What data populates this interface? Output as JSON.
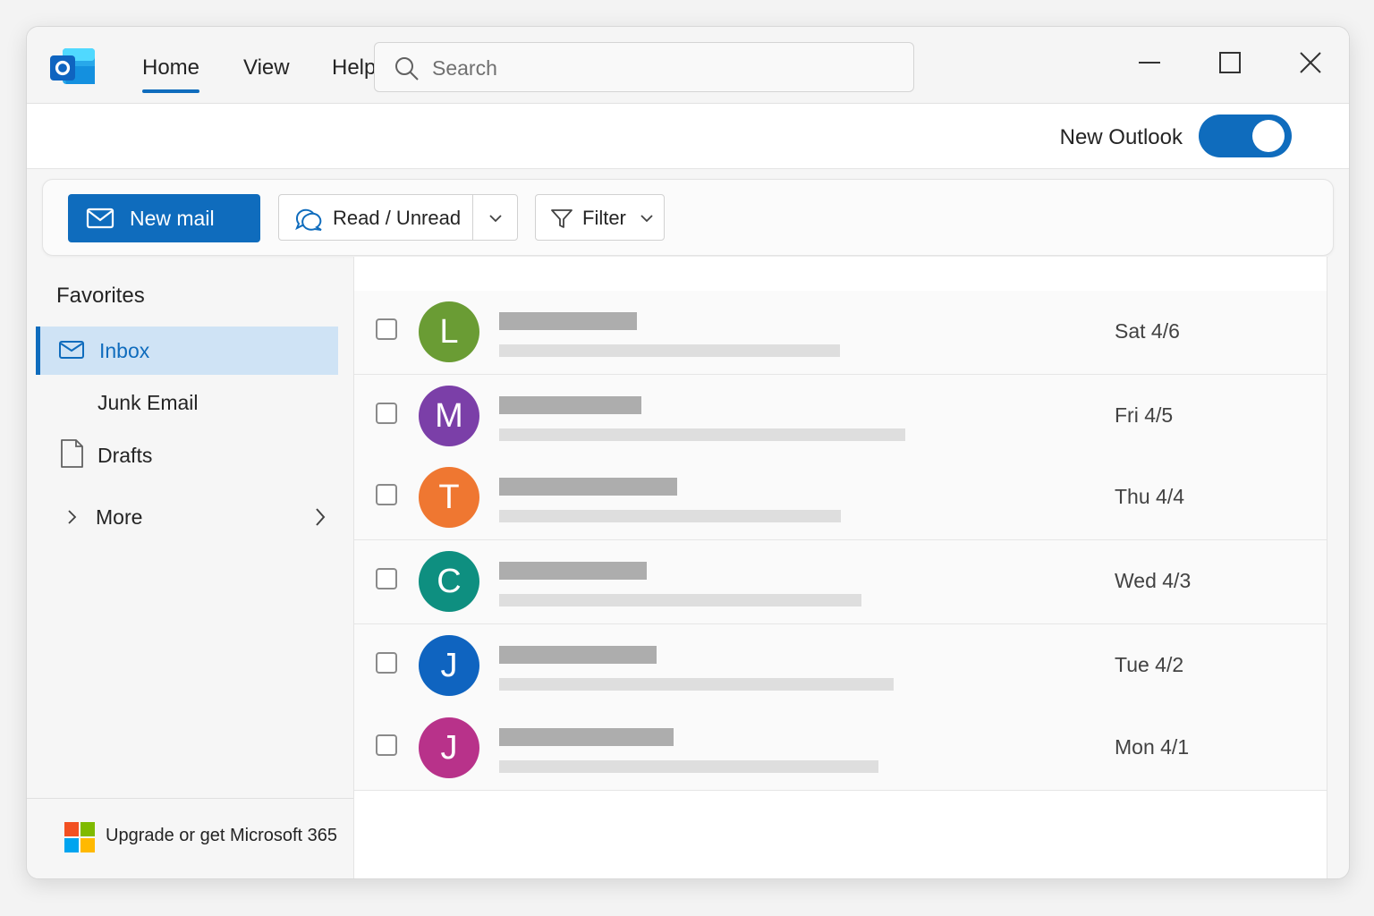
{
  "titlebar": {
    "tabs": [
      {
        "label": "Home",
        "active": true
      },
      {
        "label": "View",
        "active": false
      },
      {
        "label": "Help",
        "active": false
      }
    ],
    "search": {
      "placeholder": "Search",
      "value": ""
    },
    "window_controls": [
      "minimize-icon",
      "maximize-icon",
      "close-icon"
    ]
  },
  "topbar": {
    "new_outlook_label": "New Outlook",
    "new_outlook_toggle": true
  },
  "ribbon": {
    "new_mail_label": "New mail",
    "read_unread_label": "Read / Unread",
    "filter_label": "Filter"
  },
  "sidebar": {
    "section_title": "Favorites",
    "items": [
      {
        "label": "Inbox",
        "icon": "mail-icon",
        "selected": true
      },
      {
        "label": "Junk Email",
        "icon": "",
        "selected": false
      },
      {
        "label": "Drafts",
        "icon": "draft-icon",
        "selected": false
      },
      {
        "label": "More",
        "icon": "chevron-right-icon",
        "selected": false
      }
    ],
    "upgrade_label": "Upgrade or get Microsoft 365"
  },
  "messages": [
    {
      "initial": "L",
      "color": "#6a9c34",
      "date": "Sat 4/6"
    },
    {
      "initial": "M",
      "color": "#7b3fa8",
      "date": "Fri 4/5"
    },
    {
      "initial": "T",
      "color": "#ef7731",
      "date": "Thu 4/4"
    },
    {
      "initial": "C",
      "color": "#0e8f80",
      "date": "Wed 4/3"
    },
    {
      "initial": "J",
      "color": "#0f64c0",
      "date": "Tue 4/2"
    },
    {
      "initial": "J",
      "color": "#b8328a",
      "date": "Mon 4/1"
    }
  ],
  "colors": {
    "accent": "#0f6cbd",
    "selected_bg": "#cfe3f5"
  }
}
